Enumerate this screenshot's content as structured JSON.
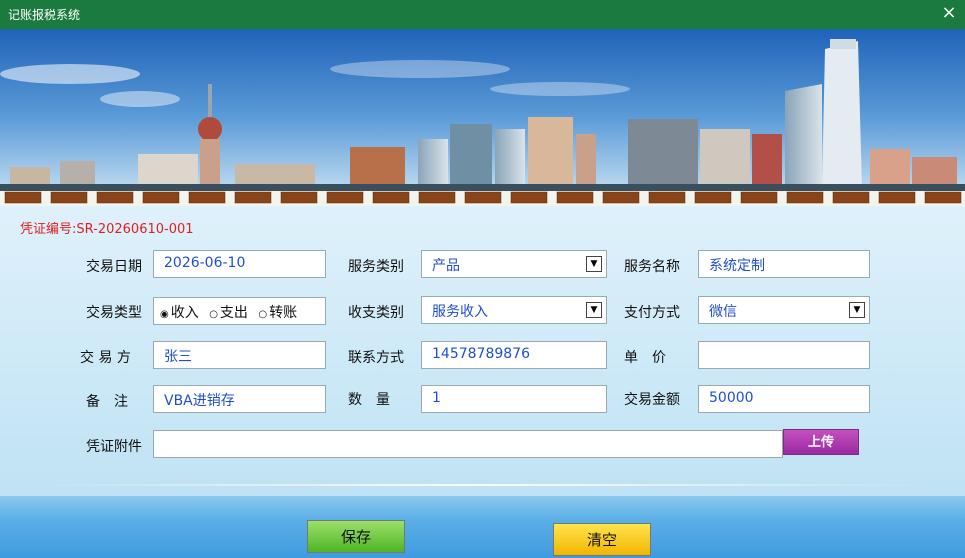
{
  "window": {
    "title": "记账报税系统",
    "close_glyph": "×"
  },
  "voucher": {
    "label": "凭证编号:",
    "number": "SR-20260610-001"
  },
  "labels": {
    "trade_date": "交易日期",
    "service_category": "服务类别",
    "service_name": "服务名称",
    "trade_type": "交易类型",
    "income_expense_category": "收支类别",
    "payment_method": "支付方式",
    "counterparty": "交 易 方",
    "contact": "联系方式",
    "unit_price": "单　价",
    "remarks": "备　注",
    "quantity": "数　量",
    "amount": "交易金额",
    "attachment": "凭证附件"
  },
  "values": {
    "trade_date": "2026-06-10",
    "service_category": "产品",
    "service_name": "系统定制",
    "income_expense_category": "服务收入",
    "payment_method": "微信",
    "counterparty": "张三",
    "contact": "14578789876",
    "unit_price": "",
    "remarks": "VBA进销存",
    "quantity": "1",
    "amount": "50000",
    "attachment": ""
  },
  "trade_type_options": [
    {
      "label": "收入",
      "selected": true
    },
    {
      "label": "支出",
      "selected": false
    },
    {
      "label": "转账",
      "selected": false
    }
  ],
  "radio_glyphs": {
    "on": "◉",
    "off": "○"
  },
  "dropdown_glyph": "▼",
  "buttons": {
    "upload": "上传",
    "save": "保存",
    "clear": "清空"
  },
  "colors": {
    "titlebar": "#1b7a3e",
    "voucher_text": "#e02020",
    "field_text": "#1f4fd1",
    "upload": "#a33aa8",
    "save": "#5dbd2f",
    "clear": "#f5c300"
  }
}
